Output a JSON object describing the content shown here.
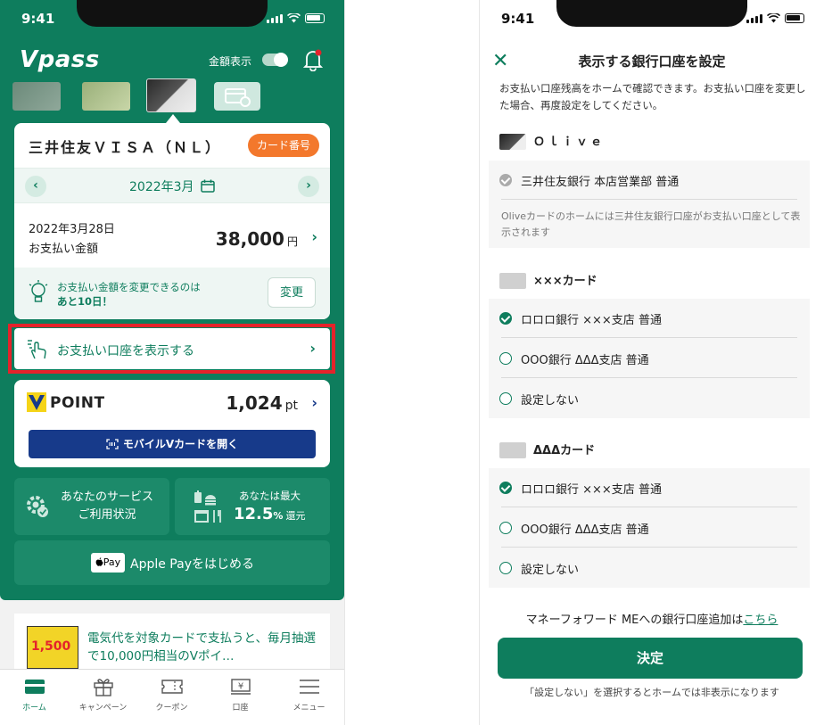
{
  "status": {
    "time_left": "9:41",
    "time_right": "9:41"
  },
  "left": {
    "app_logo": "Vpass",
    "amount_toggle_label": "金額表示",
    "amount_toggle_on": true,
    "card_name": "三井住友ＶＩＳＡ（ＮＬ）",
    "card_number_button": "カード番号",
    "month": "2022年3月",
    "payment_date": "2022年3月28日",
    "payment_label": "お支払い金額",
    "payment_amount": "38,000",
    "payment_unit": "円",
    "change_note_line1": "お支払い金額を変更できるのは",
    "change_note_line2": "あと10日！",
    "change_button": "変更",
    "show_account_label": "お支払い口座を表示する",
    "point_label": "POINT",
    "point_value": "1,024",
    "point_unit": "pt",
    "mobile_vcard_button": "モバイルVカードを開く",
    "service_line1": "あなたのサービス",
    "service_line2": "ご利用状況",
    "cashback_top": "あなたは最大",
    "cashback_value": "12.5",
    "cashback_percent": "%",
    "cashback_suffix": "還元",
    "applepay_badge": "Pay",
    "applepay_label": "Apple Payをはじめる",
    "promo_img_text": "1,500",
    "promo_text": "電気代を対象カードで支払うと、毎月抽選で10,000円相当のVポイ…",
    "tabs": [
      {
        "label": "ホーム",
        "icon": "home-card-icon",
        "active": true
      },
      {
        "label": "キャンペーン",
        "icon": "gift-icon",
        "active": false
      },
      {
        "label": "クーポン",
        "icon": "ticket-icon",
        "active": false
      },
      {
        "label": "口座",
        "icon": "yen-icon",
        "active": false
      },
      {
        "label": "メニュー",
        "icon": "menu-icon",
        "active": false
      }
    ],
    "colors": {
      "brand_green": "#0e7d5d",
      "accent_orange": "#f3782c",
      "highlight_red": "#e4232b",
      "vcard_blue": "#173a8a"
    }
  },
  "right": {
    "close_icon": "close-icon",
    "title": "表示する銀行口座を設定",
    "description": "お支払い口座残高をホームで確認できます。お支払い口座を変更した場合、再度設定をしてください。",
    "sections": [
      {
        "name": "Ｏｌｉｖｅ",
        "rows": [
          {
            "label": "三井住友銀行 本店営業部 普通",
            "state": "fixed"
          }
        ],
        "note": "Oliveカードのホームには三井住友銀行口座がお支払い口座として表示されます"
      },
      {
        "name": "×××カード",
        "rows": [
          {
            "label": "ロロロ銀行 ×××支店 普通",
            "state": "selected"
          },
          {
            "label": "OOO銀行 ΔΔΔ支店 普通",
            "state": "unselected"
          },
          {
            "label": "設定しない",
            "state": "unselected"
          }
        ]
      },
      {
        "name": "ΔΔΔカード",
        "rows": [
          {
            "label": "ロロロ銀行 ×××支店 普通",
            "state": "selected"
          },
          {
            "label": "OOO銀行 ΔΔΔ支店 普通",
            "state": "unselected"
          },
          {
            "label": "設定しない",
            "state": "unselected"
          }
        ]
      }
    ],
    "mf_text": "マネーフォワード MEへの銀行口座追加は",
    "mf_link": "こちら",
    "decide_button": "決定",
    "footer_note": "「設定しない」を選択するとホームでは非表示になります"
  }
}
